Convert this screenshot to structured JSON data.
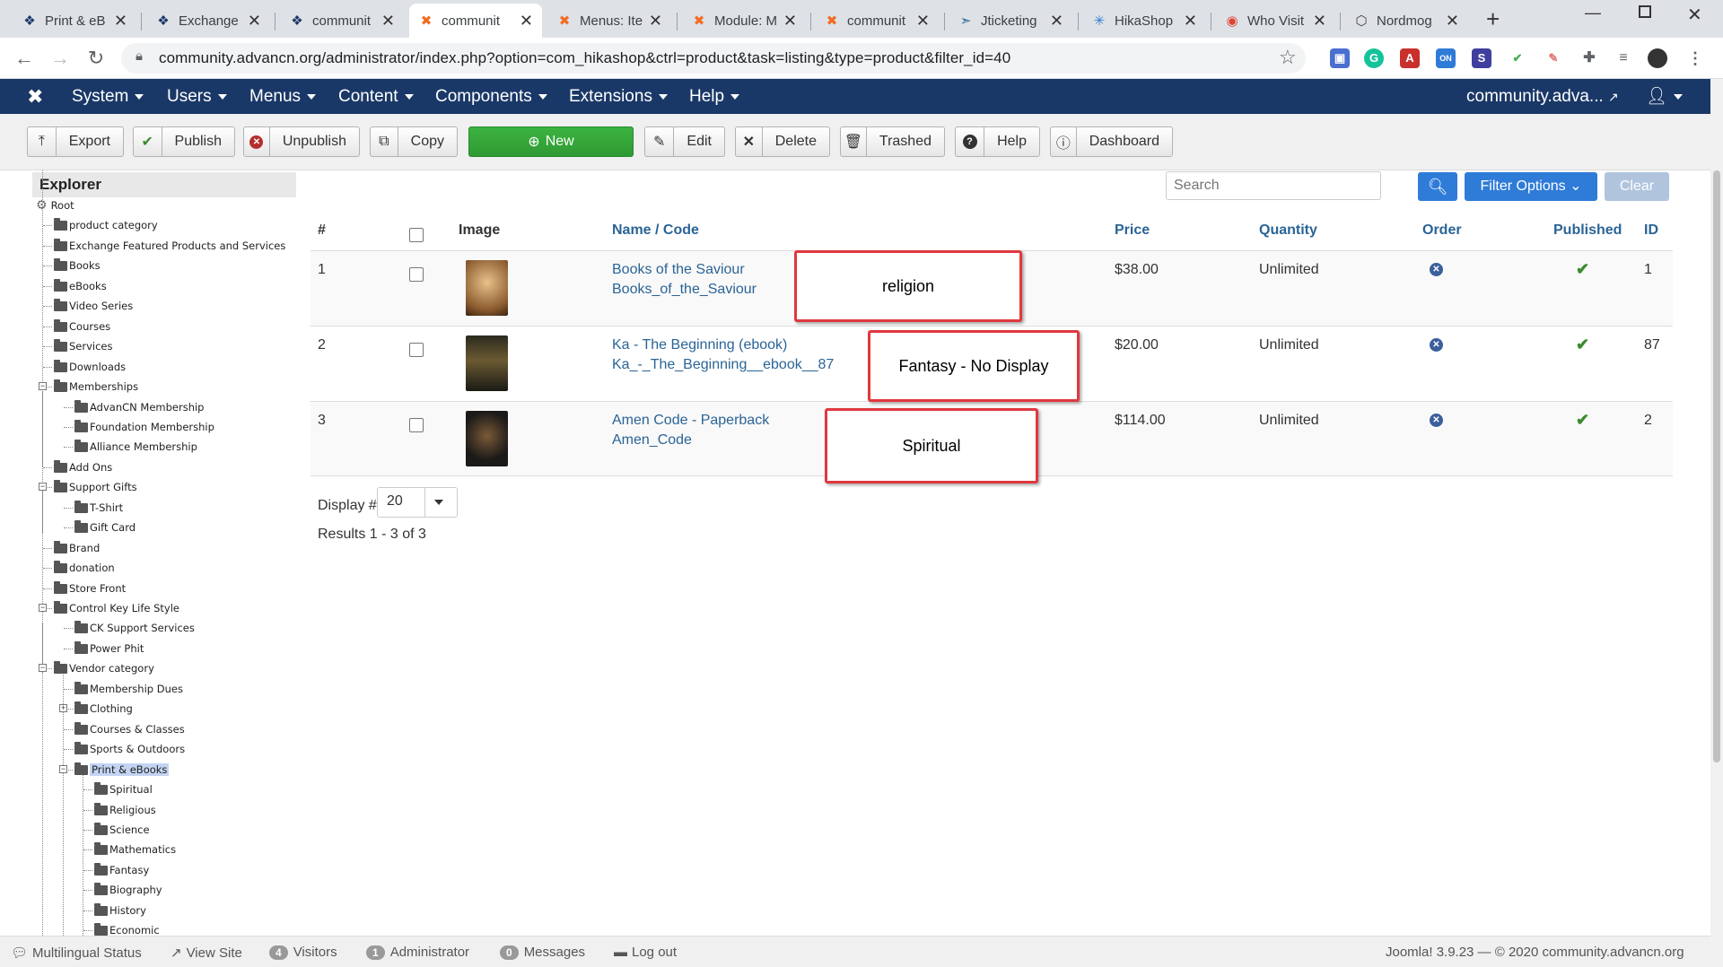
{
  "browser": {
    "tabs": [
      {
        "title": "Print & eB",
        "icon": "joomla-icon"
      },
      {
        "title": "Exchange",
        "icon": "joomla-icon"
      },
      {
        "title": "communit",
        "icon": "joomla-icon"
      },
      {
        "title": "communit",
        "icon": "joomla-x-icon"
      },
      {
        "title": "Menus: Ite",
        "icon": "joomla-x-icon"
      },
      {
        "title": "Module: M",
        "icon": "joomla-x-icon"
      },
      {
        "title": "communit",
        "icon": "joomla-x-icon"
      },
      {
        "title": "Jticketing",
        "icon": "arrow-icon"
      },
      {
        "title": "HikaShop",
        "icon": "snowflake-icon"
      },
      {
        "title": "Who Visit",
        "icon": "chrome-icon"
      },
      {
        "title": "Nordmog",
        "icon": "hexagon-icon"
      }
    ],
    "url": "community.advancn.org/administrator/index.php?option=com_hikashop&ctrl=product&task=listing&type=product&filter_id=40"
  },
  "joomla_nav": {
    "menus": [
      "System",
      "Users",
      "Menus",
      "Content",
      "Components",
      "Extensions",
      "Help"
    ],
    "site_name": "community.adva..."
  },
  "toolbar": {
    "export": "Export",
    "publish": "Publish",
    "unpublish": "Unpublish",
    "copy": "Copy",
    "new": "New",
    "edit": "Edit",
    "delete": "Delete",
    "trashed": "Trashed",
    "help": "Help",
    "dashboard": "Dashboard"
  },
  "explorer": {
    "title": "Explorer",
    "nodes": [
      {
        "label": "Root"
      },
      {
        "label": "product category"
      },
      {
        "label": "Exchange Featured Products and Services"
      },
      {
        "label": "Books"
      },
      {
        "label": "eBooks"
      },
      {
        "label": "Video Series"
      },
      {
        "label": "Courses"
      },
      {
        "label": "Services"
      },
      {
        "label": "Downloads"
      },
      {
        "label": "Memberships"
      },
      {
        "label": "AdvanCN Membership"
      },
      {
        "label": "Foundation Membership"
      },
      {
        "label": "Alliance Membership"
      },
      {
        "label": "Add Ons"
      },
      {
        "label": "Support Gifts"
      },
      {
        "label": "T-Shirt"
      },
      {
        "label": "Gift Card"
      },
      {
        "label": "Brand"
      },
      {
        "label": "donation"
      },
      {
        "label": "Store Front"
      },
      {
        "label": "Control Key Life Style"
      },
      {
        "label": "CK Support Services"
      },
      {
        "label": "Power Phit"
      },
      {
        "label": "Vendor category"
      },
      {
        "label": "Membership Dues"
      },
      {
        "label": "Clothing"
      },
      {
        "label": "Courses & Classes"
      },
      {
        "label": "Sports & Outdoors"
      },
      {
        "label": "Print & eBooks"
      },
      {
        "label": "Spiritual"
      },
      {
        "label": "Religious"
      },
      {
        "label": "Science"
      },
      {
        "label": "Mathematics"
      },
      {
        "label": "Fantasy"
      },
      {
        "label": "Biography"
      },
      {
        "label": "History"
      },
      {
        "label": "Economic"
      }
    ]
  },
  "filters": {
    "search_placeholder": "Search",
    "filter_options": "Filter Options",
    "clear": "Clear"
  },
  "table": {
    "headers": {
      "num": "#",
      "image": "Image",
      "name": "Name / Code",
      "price": "Price",
      "quantity": "Quantity",
      "order": "Order",
      "published": "Published",
      "id": "ID"
    },
    "rows": [
      {
        "num": "1",
        "name": "Books of the Saviour",
        "code": "Books_of_the_Saviour",
        "price": "$38.00",
        "quantity": "Unlimited",
        "id": "1",
        "annotation": "religion"
      },
      {
        "num": "2",
        "name": "Ka - The Beginning (ebook)",
        "code": "Ka_-_The_Beginning__ebook__87",
        "price": "$20.00",
        "quantity": "Unlimited",
        "id": "87",
        "annotation": "Fantasy - No Display"
      },
      {
        "num": "3",
        "name": "Amen Code - Paperback",
        "code": "Amen_Code",
        "price": "$114.00",
        "quantity": "Unlimited",
        "id": "2",
        "annotation": "Spiritual"
      }
    ]
  },
  "pagination": {
    "display_label": "Display #",
    "display_value": "20",
    "results": "Results 1 - 3 of 3"
  },
  "statusbar": {
    "multilingual": "Multilingual Status",
    "view_site": "View Site",
    "visitors_count": "4",
    "visitors": "Visitors",
    "admin_count": "1",
    "admin": "Administrator",
    "messages_count": "0",
    "messages": "Messages",
    "logout": "Log out",
    "footer": "Joomla! 3.9.23 — © 2020 community.advancn.org"
  },
  "colors": {
    "nav": "#1a3867",
    "new_button": "#2f9a33",
    "primary": "#2f7bd8",
    "link": "#2a6496",
    "annotation_border": "#e0383e"
  }
}
